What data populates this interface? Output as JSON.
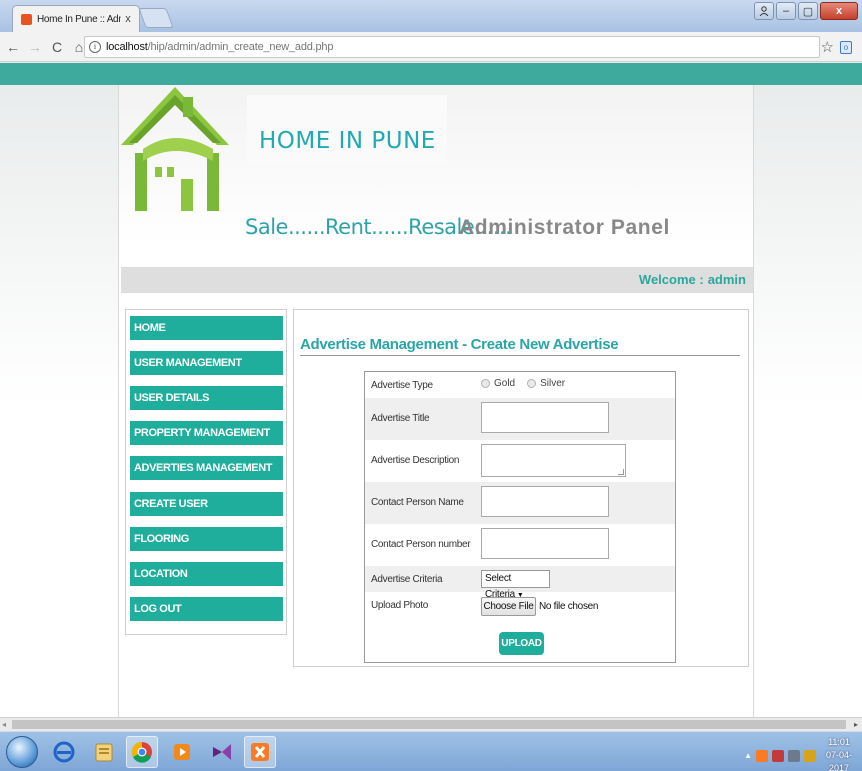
{
  "browser": {
    "tab_title": "Home In Pune :: Administ",
    "tab_close": "x",
    "url_host": "localhost",
    "url_path": "/hip/admin/admin_create_new_add.php",
    "window_controls": {
      "minimize": "–",
      "maximize": "▢",
      "close": "x"
    },
    "nav": {
      "back": "←",
      "forward": "→",
      "reload": "C",
      "home": "⌂"
    },
    "info_glyph": "i",
    "star_glyph": "☆",
    "menu_glyph": "⋮"
  },
  "header": {
    "brand": "HOME IN PUNE",
    "tagline": "Sale......Rent......Resale......",
    "panel_label": "Administrator Panel",
    "colors": {
      "accent": "#1fae9b",
      "brand_text": "#21aab1",
      "logo_green": "#8cc63f"
    }
  },
  "welcome": {
    "label": "Welcome :",
    "user": "admin"
  },
  "sidebar": {
    "items": [
      {
        "label": "HOME"
      },
      {
        "label": "USER MANAGEMENT"
      },
      {
        "label": "USER DETAILS"
      },
      {
        "label": "PROPERTY MANAGEMENT"
      },
      {
        "label": "ADVERTIES MANAGEMENT"
      },
      {
        "label": "CREATE USER"
      },
      {
        "label": "FLOORING"
      },
      {
        "label": "LOCATION"
      },
      {
        "label": "LOG OUT"
      }
    ]
  },
  "form": {
    "title": "Advertise Management - Create New Advertise",
    "type": {
      "label": "Advertise Type",
      "options": [
        "Gold",
        "Silver"
      ]
    },
    "title_field": {
      "label": "Advertise Title",
      "value": ""
    },
    "description": {
      "label": "Advertise Description",
      "value": ""
    },
    "contact_name": {
      "label": "Contact Person Name",
      "value": ""
    },
    "contact_number": {
      "label": "Contact Person number",
      "value": ""
    },
    "criteria": {
      "label": "Advertise Criteria",
      "selected": "Select Criteria",
      "caret": "▼"
    },
    "photo": {
      "label": "Upload Photo",
      "button": "Choose File",
      "status": "No file chosen"
    },
    "submit": "UPLOAD"
  },
  "taskbar": {
    "apps": [
      "start-orb",
      "internet-explorer",
      "file-explorer",
      "chrome",
      "media-player",
      "visual-studio",
      "xampp"
    ],
    "clock_time": "11:01",
    "clock_date": "07-04-2017",
    "tray_arrow": "▲"
  }
}
